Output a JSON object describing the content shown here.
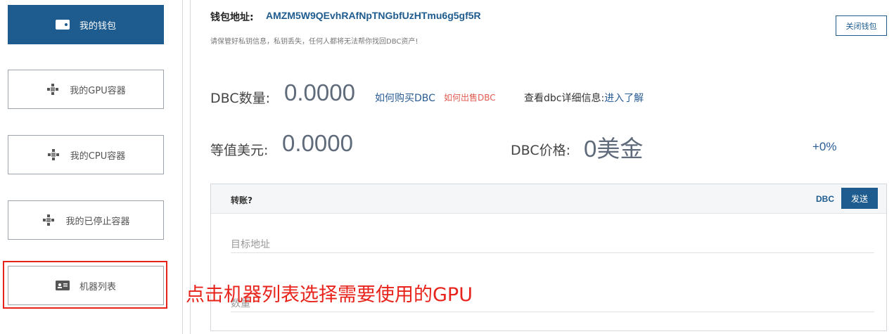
{
  "sidebar": {
    "items": [
      {
        "label": "我的钱包",
        "icon": "wallet-icon"
      },
      {
        "label": "我的GPU容器",
        "icon": "container-icon"
      },
      {
        "label": "我的CPU容器",
        "icon": "container-icon"
      },
      {
        "label": "我的已停止容器",
        "icon": "container-icon"
      },
      {
        "label": "机器列表",
        "icon": "id-card-icon"
      }
    ],
    "active_index": 0
  },
  "wallet": {
    "address_label": "钱包地址:",
    "address": "AMZM5W9QEvhRAfNpTNGbfUzHTmu6g5gf5R",
    "warning": "请保管好私钥信息，私钥丢失，任何人都将无法帮你找回DBC资产!",
    "close_button": "关闭钱包"
  },
  "balance": {
    "dbc_label": "DBC数量:",
    "dbc_value": "0.0000",
    "buy_link": "如何购买DBC",
    "sell_link": "如何出售DBC",
    "detail_prefix": "查看dbc详细信息:",
    "detail_link": "进入了解",
    "usd_label": "等值美元:",
    "usd_value": "0.0000",
    "price_label": "DBC价格:",
    "price_value": "0美金",
    "change": "+0%"
  },
  "transfer": {
    "title": "转账?",
    "currency": "DBC",
    "send_button": "发送",
    "address_placeholder": "目标地址",
    "quantity_placeholder": "数量"
  },
  "annotation": "点击机器列表选择需要使用的GPU",
  "colors": {
    "accent": "#1e5b8e",
    "highlight": "#e8231b",
    "sell_link": "#e05a4f"
  }
}
